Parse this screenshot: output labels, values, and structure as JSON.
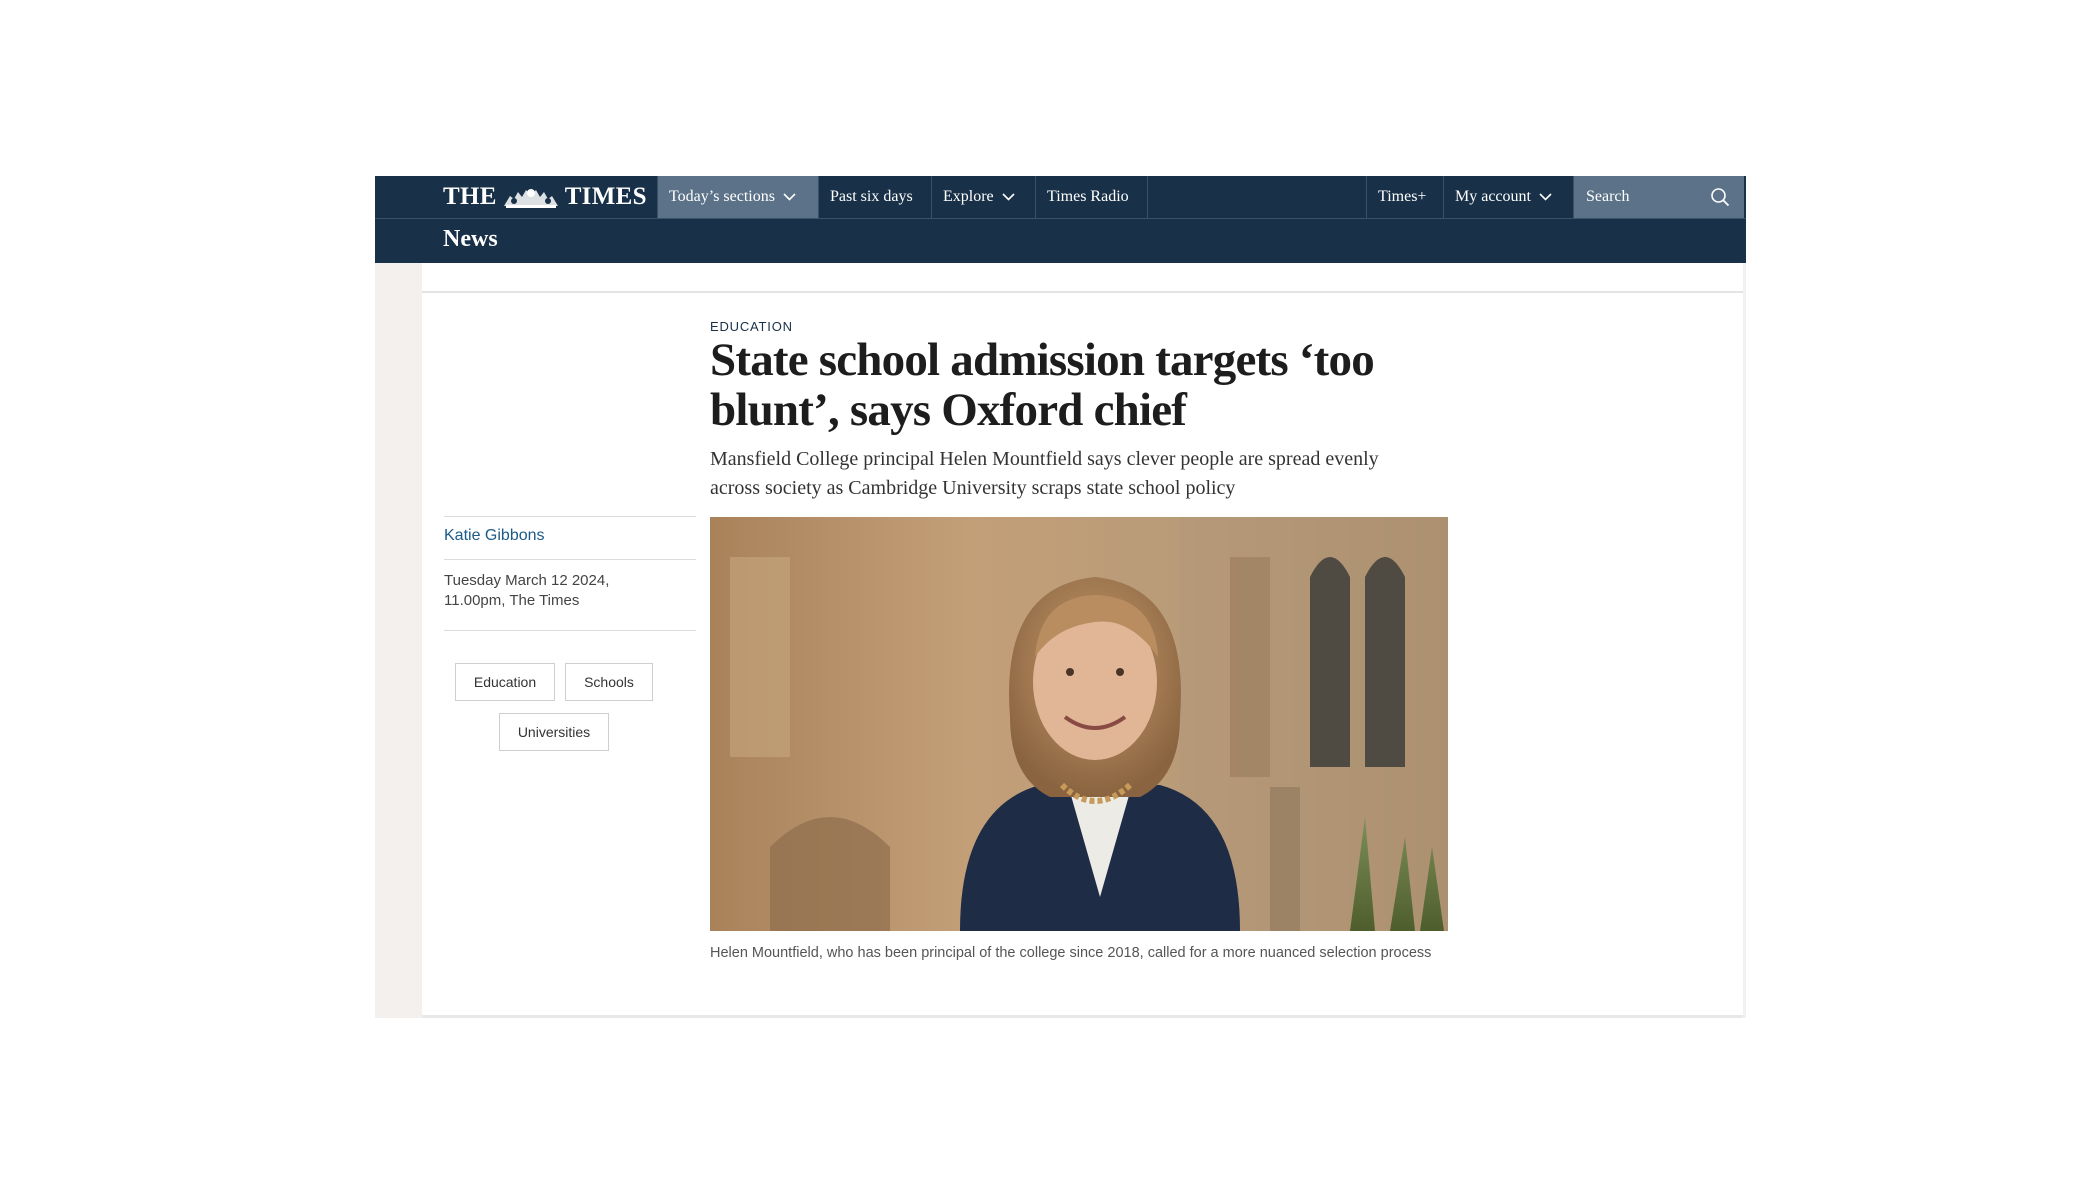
{
  "nav": {
    "logo_left": "THE",
    "logo_right": "TIMES",
    "items": [
      {
        "label": "Today’s sections",
        "dropdown": true,
        "active": true
      },
      {
        "label": "Past six days",
        "dropdown": false
      },
      {
        "label": "Explore",
        "dropdown": true
      },
      {
        "label": "Times Radio",
        "dropdown": false
      }
    ],
    "right_items": [
      {
        "label": "Times+",
        "dropdown": false
      },
      {
        "label": "My account",
        "dropdown": true
      }
    ],
    "search_placeholder": "Search"
  },
  "section": {
    "title": "News"
  },
  "article": {
    "kicker": "EDUCATION",
    "headline": "State school admission targets ‘too blunt’, says Oxford chief",
    "standfirst": "Mansfield College principal Helen Mountfield says clever people are spread evenly across society as Cambridge University scraps state school policy",
    "author": "Katie Gibbons",
    "date_line1": "Tuesday March 12 2024,",
    "date_line2": "11.00pm, The Times",
    "tags": [
      "Education",
      "Schools",
      "Universities"
    ],
    "caption": "Helen Mountfield, who has been principal of the college since 2018, called for a more nuanced selection process"
  },
  "colors": {
    "nav_background": "#183048",
    "nav_active": "#5b7288",
    "author_link": "#1b5a89",
    "page_side": "#f3f0ed"
  }
}
